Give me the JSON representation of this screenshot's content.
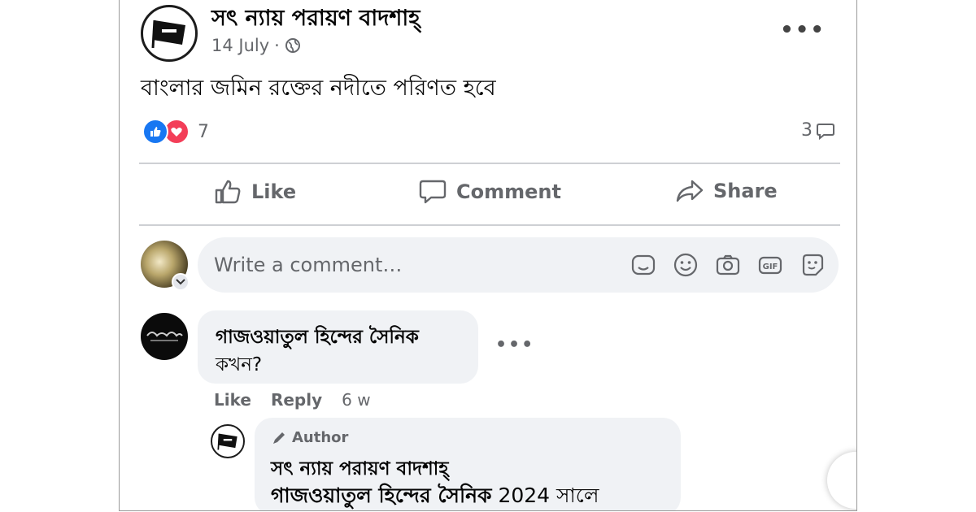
{
  "post": {
    "page_name": "সৎ ন্যায় পরায়ণ বাদশাহ্",
    "date": "14 July",
    "separator": "·",
    "privacy_icon": "globe-icon",
    "text": "বাংলার জমিন রক্তের নদীতে পরিণত হবে",
    "reaction_count": "7",
    "comment_count": "3"
  },
  "actions": {
    "like": "Like",
    "comment": "Comment",
    "share": "Share"
  },
  "write_comment": {
    "placeholder": "Write a comment…",
    "icons": [
      "sticker-icon",
      "emoji-icon",
      "camera-icon",
      "gif-icon",
      "avatar-sticker-icon"
    ]
  },
  "comments": [
    {
      "author": "গাজওয়াতুল হিন্দের সৈনিক",
      "text": "কখন?",
      "like_label": "Like",
      "reply_label": "Reply",
      "age": "6 w",
      "reply": {
        "badge": "Author",
        "author": "সৎ ন্যায় পরায়ণ বাদশাহ্",
        "mention": "গাজওয়াতুল হিন্দের সৈনিক",
        "text": "2024 সালে"
      }
    }
  ],
  "colors": {
    "accent": "#1877f2",
    "love": "#f33e58",
    "muted": "#65676b",
    "bubble": "#f0f2f5"
  }
}
